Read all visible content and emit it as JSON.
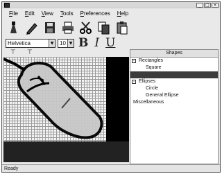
{
  "menubar": {
    "items": [
      "File",
      "Edit",
      "View",
      "Tools",
      "Preferences",
      "Help"
    ]
  },
  "toolbar": {
    "buttons": [
      "pen-icon",
      "pencil-icon",
      "save-icon",
      "print-icon",
      "scissors-icon",
      "copy-icon",
      "paste-icon"
    ]
  },
  "format": {
    "font": "Helvetica",
    "size": "10",
    "bold": "B",
    "italic": "I",
    "underline": "U"
  },
  "ruler": {
    "marks": [
      "⊤",
      "⊤"
    ]
  },
  "shapes_panel": {
    "title": "Shapes",
    "items": [
      {
        "label": "Rectangles",
        "level": 0,
        "toggle": "-"
      },
      {
        "label": "Square",
        "level": 1
      },
      {
        "label": "",
        "level": 1,
        "selected": true
      },
      {
        "label": "Ellipses",
        "level": 0,
        "toggle": "-"
      },
      {
        "label": "Circle",
        "level": 1
      },
      {
        "label": "General Ellipse",
        "level": 1
      },
      {
        "label": "Miscellaneous",
        "level": 0
      }
    ]
  },
  "statusbar": {
    "text": "Ready"
  },
  "colors": {
    "canvas_background": "#000000",
    "grid_line": "#9a9a9a",
    "selection": "#3c3c3c"
  }
}
